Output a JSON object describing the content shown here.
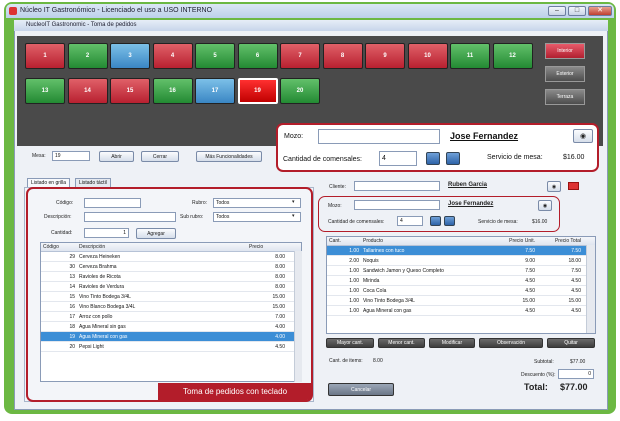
{
  "window": {
    "title": "Núcleo IT Gastronómico - Licenciado el uso a USO INTERNO"
  },
  "app": {
    "title": "NucleoIT Gastronomic - Toma de pedidos"
  },
  "tables": [
    "1",
    "2",
    "3",
    "4",
    "5",
    "6",
    "7",
    "8",
    "9",
    "10",
    "11",
    "12",
    "13",
    "14",
    "15",
    "16",
    "17",
    "19",
    "20"
  ],
  "table_colors": [
    "r",
    "g",
    "b",
    "r",
    "g",
    "g",
    "r",
    "r",
    "r",
    "r",
    "g",
    "g",
    "g",
    "r",
    "r",
    "g",
    "b",
    "sel",
    "g"
  ],
  "zones": [
    "Interior",
    "Exterior",
    "Terraza"
  ],
  "mesa": {
    "label": "Mesa:",
    "value": "19",
    "abrir": "Abrir",
    "cerrar": "Cerrar",
    "mas": "Más Funcionalidades"
  },
  "tabs": [
    "Listado en grilla",
    "Listado táctil"
  ],
  "filters": {
    "codigo": "Código:",
    "descripcion": "Descripción:",
    "cantidad": "Cantidad:",
    "cantidad_value": "1",
    "rubro": "Rubro:",
    "rubro_value": "Todos",
    "subrubro": "Sub rubro:",
    "subrubro_value": "Todos",
    "agregar": "Agregar"
  },
  "products": {
    "headers": [
      "Código",
      "Descripción",
      "Precio"
    ],
    "rows": [
      [
        "29",
        "Cerveza Heineken",
        "8.00"
      ],
      [
        "30",
        "Cerveza Brahma",
        "8.00"
      ],
      [
        "13",
        "Ravioles de Ricota",
        "8.00"
      ],
      [
        "14",
        "Ravioles de Verdura",
        "8.00"
      ],
      [
        "15",
        "Vino Tinto Bodega 3/4L",
        "15.00"
      ],
      [
        "16",
        "Vino Blanco Bodega 3/4L",
        "15.00"
      ],
      [
        "17",
        "Arroz con pollo",
        "7.00"
      ],
      [
        "18",
        "Agua Mineral sin gas",
        "4.00"
      ],
      [
        "19",
        "Agua Mineral con gas",
        "4.00"
      ],
      [
        "20",
        "Pepsi Light",
        "4.50"
      ]
    ]
  },
  "caption": "Toma de pedidos con teclado",
  "cliente": {
    "label": "Cliente:",
    "name": "Ruben Garcia"
  },
  "mozo": {
    "label": "Mozo:",
    "name": "Jose Fernandez",
    "comensales_label": "Cantidad de comensales:",
    "comensales": "4",
    "servicio_label": "Servicio de mesa:",
    "servicio": "$16.00"
  },
  "zoom": {
    "label": "Mozo:",
    "name": "Jose Fernandez",
    "comensales_label": "Cantidad de comensales:",
    "comensales": "4",
    "servicio_label": "Servicio de mesa:",
    "servicio": "$16.00"
  },
  "order": {
    "headers": [
      "Cant.",
      "Producto",
      "Precio Unit.",
      "Precio Total"
    ],
    "rows": [
      [
        "1.00",
        "Tallarines con tuco",
        "7.50",
        "7.50"
      ],
      [
        "2.00",
        "Ñoquis",
        "9.00",
        "18.00"
      ],
      [
        "1.00",
        "Sandwich Jamon y Queso Completo",
        "7.50",
        "7.50"
      ],
      [
        "1.00",
        "Mirinda",
        "4.50",
        "4.50"
      ],
      [
        "1.00",
        "Coca Cola",
        "4.50",
        "4.50"
      ],
      [
        "1.00",
        "Vino Tinto Bodega 3/4L",
        "15.00",
        "15.00"
      ],
      [
        "1.00",
        "Agua Mineral con gas",
        "4.50",
        "4.50"
      ]
    ]
  },
  "actions": [
    "Mayor cant.",
    "Menor cant.",
    "Modificar",
    "Observación",
    "Quitar"
  ],
  "totals": {
    "items_label": "Cant. de items:",
    "items": "8.00",
    "subtotal_label": "Subtotal:",
    "subtotal": "$77.00",
    "descuento_label": "Descuento (%):",
    "descuento": "0",
    "total_label": "Total:",
    "total": "$77.00"
  },
  "cancelar": "Cancelar"
}
